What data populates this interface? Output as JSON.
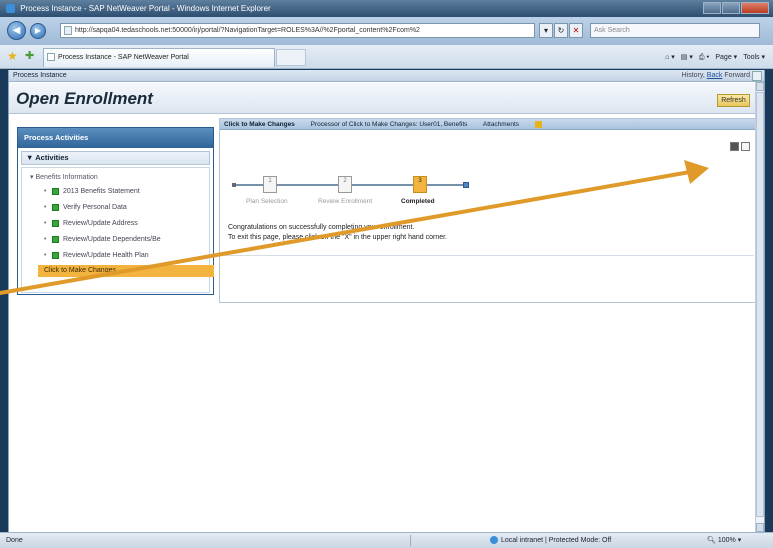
{
  "browser": {
    "window_title": "Process Instance - SAP NetWeaver Portal - Windows Internet Explorer",
    "address_url": "http://sapqa04.tedaschools.net:50000/irj/portal/?NavigationTarget=ROLES%3A//%2Fportal_content%2Fcom%2",
    "search_placeholder": "Ask Search",
    "tab_label": "Process Instance - SAP NetWeaver Portal",
    "commands": [
      "Page ▾",
      "Tools ▾"
    ],
    "status_left": "Done",
    "status_zone": "Local intranet | Protected Mode: Off",
    "status_zoom": "100%"
  },
  "portal": {
    "breadcrumb": "Process Instance",
    "history_label": "History,",
    "back_label": "Back",
    "forward_label": "Forward",
    "page_title": "Open Enrollment",
    "refresh_label": "Refresh"
  },
  "left_panel": {
    "header": "Process Activities",
    "section": "Activities",
    "root": "Benefits Information",
    "items": [
      {
        "label": "2013 Benefits Statement"
      },
      {
        "label": "Verify Personal Data"
      },
      {
        "label": "Review/Update Address"
      },
      {
        "label": "Review/Update Dependents/Be"
      },
      {
        "label": "Review/Update Health Plan"
      },
      {
        "label": "Click to Make Changes"
      }
    ],
    "colors": {
      "selected": "#f2b33f",
      "header": "#2f649a",
      "complete": "#3aa53a"
    }
  },
  "main_panel": {
    "bar_title": "Click to Make Changes",
    "bar_processor": "Processor of Click to Make Changes: User01, Benefits",
    "bar_attachments": "Attachments",
    "steps": [
      {
        "number": "1",
        "label": "Plan Selection",
        "active": false
      },
      {
        "number": "2",
        "label": "Review Enrollment",
        "active": false
      },
      {
        "number": "3",
        "label": "Completed",
        "active": true
      }
    ],
    "message_line1": "Congratulations on successfully completing your enrollment.",
    "message_line2": "To exit this page, please click on the \"X\" in the upper right hand corner."
  },
  "callout": {
    "color": "#e09a2a"
  }
}
